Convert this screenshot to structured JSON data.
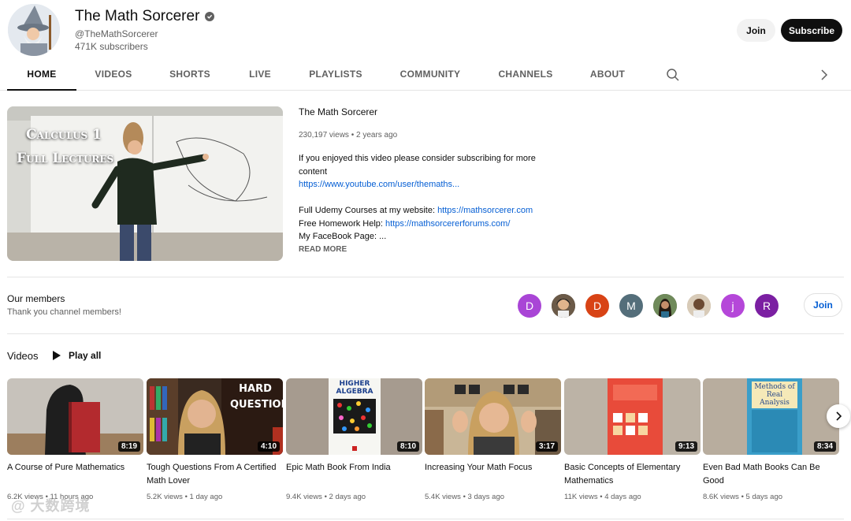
{
  "channel": {
    "name": "The Math Sorcerer",
    "handle": "@TheMathSorcerer",
    "subscribers": "471K subscribers",
    "join_label": "Join",
    "subscribe_label": "Subscribe"
  },
  "tabs": [
    {
      "label": "HOME",
      "active": true
    },
    {
      "label": "VIDEOS",
      "active": false
    },
    {
      "label": "SHORTS",
      "active": false
    },
    {
      "label": "LIVE",
      "active": false
    },
    {
      "label": "PLAYLISTS",
      "active": false
    },
    {
      "label": "COMMUNITY",
      "active": false
    },
    {
      "label": "CHANNELS",
      "active": false
    },
    {
      "label": "ABOUT",
      "active": false
    }
  ],
  "featured": {
    "thumbnail_text_line1": "Calculus 1",
    "thumbnail_text_line2": "Full Lectures",
    "title": "The Math Sorcerer",
    "meta": "230,197 views • 2 years ago",
    "desc_line1": "If you enjoyed this video please consider subscribing for more content",
    "desc_link1": "https://www.youtube.com/user/themaths...",
    "desc_line2_prefix": "Full Udemy Courses at my website: ",
    "desc_link2": "https://mathsorcerer.com",
    "desc_line3_prefix": "Free Homework Help: ",
    "desc_link3": "https://mathsorcererforums.com/",
    "desc_line4": "My FaceBook Page: ...",
    "read_more": "READ MORE"
  },
  "members": {
    "title": "Our members",
    "subtitle": "Thank you channel members!",
    "join_label": "Join",
    "avatars": [
      {
        "initial": "D",
        "color": "#a945d6"
      },
      {
        "initial": "",
        "color": "#3a3a3a"
      },
      {
        "initial": "D",
        "color": "#d84315"
      },
      {
        "initial": "M",
        "color": "#546e7a"
      },
      {
        "initial": "",
        "color": "#5a6a4a"
      },
      {
        "initial": "",
        "color": "#c9b49a"
      },
      {
        "initial": "j",
        "color": "#b547d9"
      },
      {
        "initial": "R",
        "color": "#7b1fa2"
      }
    ]
  },
  "videos_shelf": {
    "title": "Videos",
    "play_all": "Play all",
    "items": [
      {
        "title": "A Course of Pure Mathematics",
        "meta": "6.2K views • 11 hours ago",
        "duration": "8:19"
      },
      {
        "title": "Tough Questions From A Certified Math Lover",
        "meta": "5.2K views • 1 day ago",
        "duration": "4:10",
        "thumb_text": "HARD QUESTIONS"
      },
      {
        "title": "Epic Math Book From India",
        "meta": "9.4K views • 2 days ago",
        "duration": "8:10",
        "thumb_text": "HIGHER ALGEBRA"
      },
      {
        "title": "Increasing Your Math Focus",
        "meta": "5.4K views • 3 days ago",
        "duration": "3:17"
      },
      {
        "title": "Basic Concepts of Elementary Mathematics",
        "meta": "11K views • 4 days ago",
        "duration": "9:13"
      },
      {
        "title": "Even Bad Math Books Can Be Good",
        "meta": "8.6K views • 5 days ago",
        "duration": "8:34",
        "thumb_text": "Methods of Real Analysis"
      }
    ]
  },
  "watermark": "@ 大数跨境"
}
